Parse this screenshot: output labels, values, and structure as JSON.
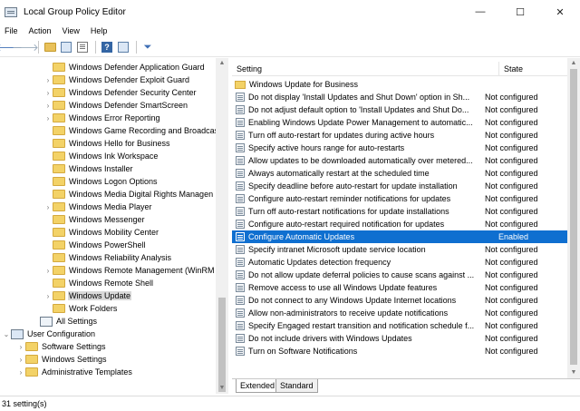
{
  "window": {
    "title": "Local Group Policy Editor",
    "minimize": "—",
    "maximize": "☐",
    "close": "✕"
  },
  "menu": [
    "File",
    "Action",
    "View",
    "Help"
  ],
  "toolbar": {
    "back": "🡐",
    "forward": "🡒"
  },
  "tree": {
    "items": [
      {
        "label": "Windows Defender Application Guard",
        "chevron": ""
      },
      {
        "label": "Windows Defender Exploit Guard",
        "chevron": "›"
      },
      {
        "label": "Windows Defender Security Center",
        "chevron": "›"
      },
      {
        "label": "Windows Defender SmartScreen",
        "chevron": "›"
      },
      {
        "label": "Windows Error Reporting",
        "chevron": "›"
      },
      {
        "label": "Windows Game Recording and Broadcas",
        "chevron": ""
      },
      {
        "label": "Windows Hello for Business",
        "chevron": ""
      },
      {
        "label": "Windows Ink Workspace",
        "chevron": ""
      },
      {
        "label": "Windows Installer",
        "chevron": ""
      },
      {
        "label": "Windows Logon Options",
        "chevron": ""
      },
      {
        "label": "Windows Media Digital Rights Managen",
        "chevron": ""
      },
      {
        "label": "Windows Media Player",
        "chevron": "›"
      },
      {
        "label": "Windows Messenger",
        "chevron": ""
      },
      {
        "label": "Windows Mobility Center",
        "chevron": ""
      },
      {
        "label": "Windows PowerShell",
        "chevron": ""
      },
      {
        "label": "Windows Reliability Analysis",
        "chevron": ""
      },
      {
        "label": "Windows Remote Management (WinRM",
        "chevron": "›"
      },
      {
        "label": "Windows Remote Shell",
        "chevron": ""
      },
      {
        "label": "Windows Update",
        "chevron": "›"
      },
      {
        "label": "Work Folders",
        "chevron": ""
      }
    ],
    "all_settings": "All Settings",
    "user_config": {
      "label": "User Configuration",
      "chevron": "⌄"
    },
    "user_children": [
      {
        "label": "Software Settings",
        "chevron": "›"
      },
      {
        "label": "Windows Settings",
        "chevron": "›"
      },
      {
        "label": "Administrative Templates",
        "chevron": "›"
      }
    ]
  },
  "columns": {
    "setting": "Setting",
    "state": "State"
  },
  "settings": {
    "folder": "Windows Update for Business",
    "rows": [
      {
        "name": "Do not display 'Install Updates and Shut Down' option in Sh...",
        "state": "Not configured"
      },
      {
        "name": "Do not adjust default option to 'Install Updates and Shut Do...",
        "state": "Not configured"
      },
      {
        "name": "Enabling Windows Update Power Management to automatic...",
        "state": "Not configured"
      },
      {
        "name": "Turn off auto-restart for updates during active hours",
        "state": "Not configured"
      },
      {
        "name": "Specify active hours range for auto-restarts",
        "state": "Not configured"
      },
      {
        "name": "Allow updates to be downloaded automatically over metered...",
        "state": "Not configured"
      },
      {
        "name": "Always automatically restart at the scheduled time",
        "state": "Not configured"
      },
      {
        "name": "Specify deadline before auto-restart for update installation",
        "state": "Not configured"
      },
      {
        "name": "Configure auto-restart reminder notifications for updates",
        "state": "Not configured"
      },
      {
        "name": "Turn off auto-restart notifications for update installations",
        "state": "Not configured"
      },
      {
        "name": "Configure auto-restart required notification for updates",
        "state": "Not configured"
      },
      {
        "name": "Configure Automatic Updates",
        "state": "Enabled"
      },
      {
        "name": "Specify intranet Microsoft update service location",
        "state": "Not configured"
      },
      {
        "name": "Automatic Updates detection frequency",
        "state": "Not configured"
      },
      {
        "name": "Do not allow update deferral policies to cause scans against ...",
        "state": "Not configured"
      },
      {
        "name": "Remove access to use all Windows Update features",
        "state": "Not configured"
      },
      {
        "name": "Do not connect to any Windows Update Internet locations",
        "state": "Not configured"
      },
      {
        "name": "Allow non-administrators to receive update notifications",
        "state": "Not configured"
      },
      {
        "name": "Specify Engaged restart transition and notification schedule f...",
        "state": "Not configured"
      },
      {
        "name": "Do not include drivers with Windows Updates",
        "state": "Not configured"
      },
      {
        "name": "Turn on Software Notifications",
        "state": "Not configured"
      }
    ]
  },
  "tabs": [
    "Extended",
    "Standard"
  ],
  "status": "31 setting(s)"
}
